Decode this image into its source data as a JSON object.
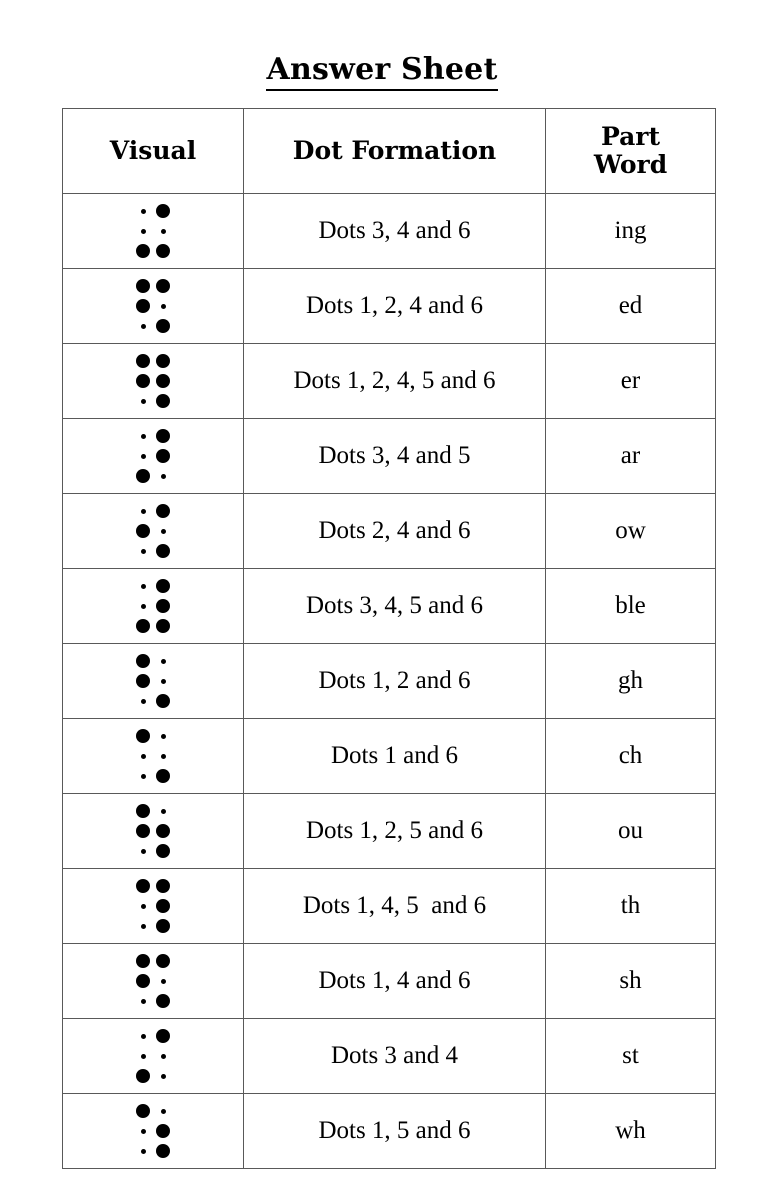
{
  "page": {
    "title": "Answer Sheet"
  },
  "table": {
    "headers": {
      "visual": "Visual",
      "dot_formation": "Dot Formation",
      "part_word": "Part\nWord"
    },
    "rows": [
      {
        "dots": [
          3,
          4,
          6
        ],
        "dot_formation": "Dots 3, 4 and 6",
        "part_word": "ing"
      },
      {
        "dots": [
          1,
          2,
          4,
          6
        ],
        "dot_formation": "Dots 1, 2, 4 and 6",
        "part_word": "ed"
      },
      {
        "dots": [
          1,
          2,
          4,
          5,
          6
        ],
        "dot_formation": "Dots 1, 2, 4, 5 and 6",
        "part_word": "er"
      },
      {
        "dots": [
          3,
          4,
          5
        ],
        "dot_formation": "Dots 3, 4 and 5",
        "part_word": "ar"
      },
      {
        "dots": [
          2,
          4,
          6
        ],
        "dot_formation": "Dots 2, 4 and 6",
        "part_word": "ow"
      },
      {
        "dots": [
          3,
          4,
          5,
          6
        ],
        "dot_formation": "Dots 3, 4, 5 and 6",
        "part_word": "ble"
      },
      {
        "dots": [
          1,
          2,
          6
        ],
        "dot_formation": "Dots 1, 2 and 6",
        "part_word": "gh"
      },
      {
        "dots": [
          1,
          6
        ],
        "dot_formation": "Dots 1 and 6",
        "part_word": "ch"
      },
      {
        "dots": [
          1,
          2,
          5,
          6
        ],
        "dot_formation": "Dots 1, 2, 5 and 6",
        "part_word": "ou"
      },
      {
        "dots": [
          1,
          4,
          5,
          6
        ],
        "dot_formation": "Dots 1, 4, 5  and 6",
        "part_word": "th"
      },
      {
        "dots": [
          1,
          2,
          4,
          6
        ],
        "dot_formation": "Dots 1, 4 and 6",
        "part_word": "sh"
      },
      {
        "dots": [
          3,
          4
        ],
        "dot_formation": "Dots 3 and 4",
        "part_word": "st"
      },
      {
        "dots": [
          1,
          5,
          6
        ],
        "dot_formation": "Dots 1, 5 and 6",
        "part_word": "wh"
      }
    ]
  },
  "style": {
    "border_color": "#595959",
    "text_color": "#000000",
    "background": "#ffffff"
  }
}
